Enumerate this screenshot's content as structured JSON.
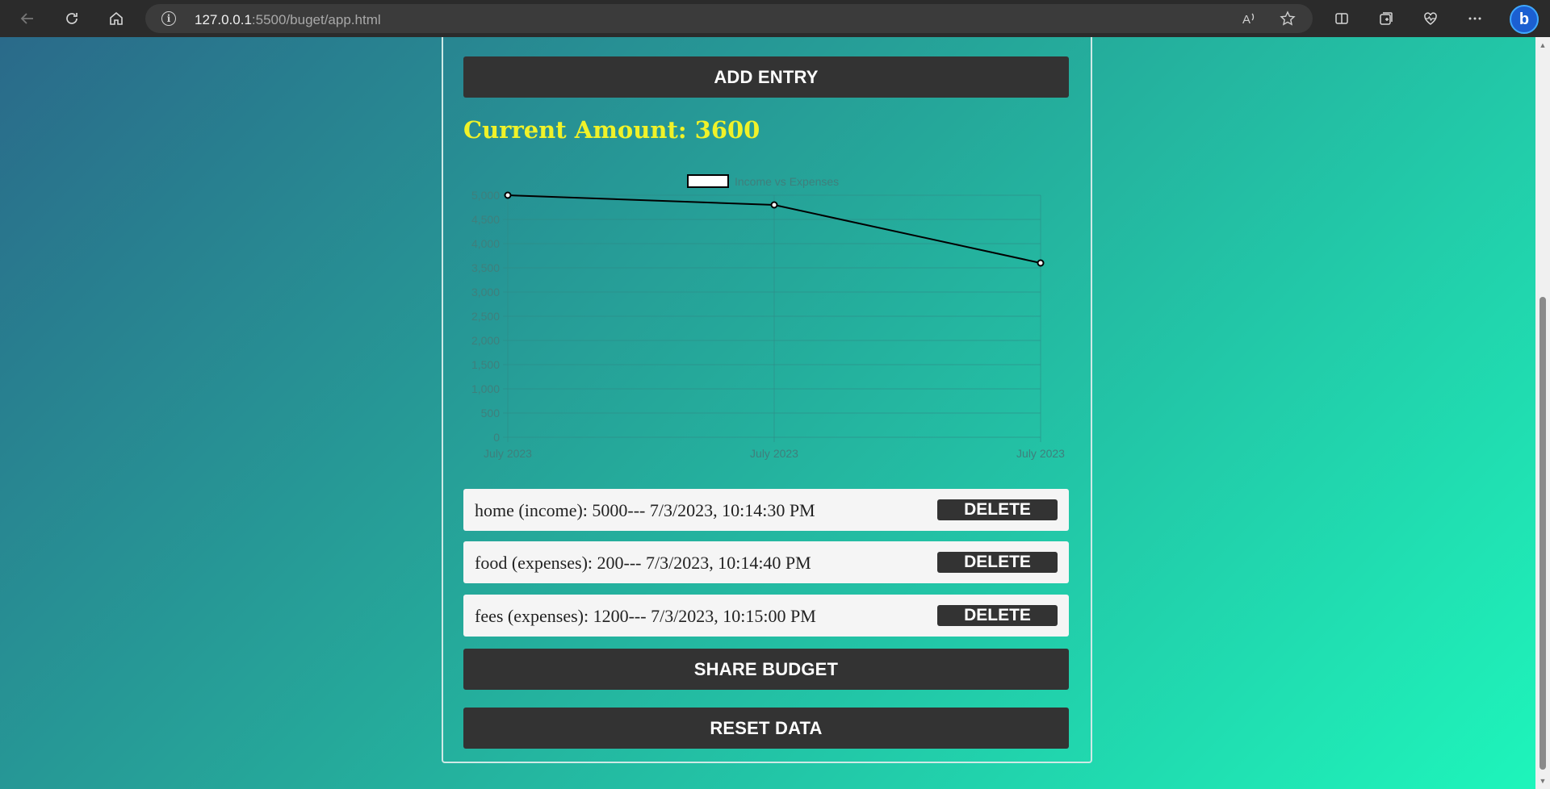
{
  "browser": {
    "url_host": "127.0.0.1",
    "url_rest": ":5500/buget/app.html"
  },
  "page": {
    "add_entry_label": "ADD ENTRY",
    "current_amount": "Current Amount: 3600",
    "share_label": "SHARE BUDGET",
    "reset_label": "RESET DATA",
    "delete_label": "DELETE",
    "entries": [
      "home (income): 5000--- 7/3/2023, 10:14:30 PM",
      "food (expenses): 200--- 7/3/2023, 10:14:40 PM",
      "fees (expenses): 1200--- 7/3/2023, 10:15:00 PM"
    ]
  },
  "colors": {
    "accent_yellow": "#f0f229",
    "button_dark": "#333333",
    "gradient_start": "#2a6a8a",
    "gradient_end": "#1ef5bb"
  },
  "chart_data": {
    "type": "line",
    "categories": [
      "July 2023",
      "July 2023",
      "July 2023"
    ],
    "series": [
      {
        "name": "Income vs Expenses",
        "values": [
          5000,
          4800,
          3600
        ]
      }
    ],
    "ylim": [
      0,
      5000
    ],
    "yticks": [
      "0",
      "500",
      "1,000",
      "1,500",
      "2,000",
      "2,500",
      "3,000",
      "3,500",
      "4,000",
      "4,500",
      "5,000"
    ],
    "legend_position": "top",
    "grid": true
  }
}
